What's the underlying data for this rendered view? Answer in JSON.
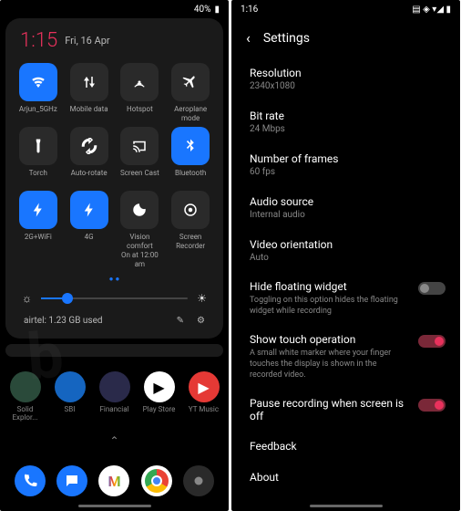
{
  "left_phone": {
    "status": {
      "battery": "40%"
    },
    "clock": {
      "time": "1:15",
      "date": "Fri, 16 Apr"
    },
    "tiles": [
      {
        "label": "Arjun_5GHz",
        "on": true,
        "icon": "wifi"
      },
      {
        "label": "Mobile data",
        "on": false,
        "icon": "data"
      },
      {
        "label": "Hotspot",
        "on": false,
        "icon": "hotspot"
      },
      {
        "label": "Aeroplane mode",
        "on": false,
        "icon": "plane"
      },
      {
        "label": "Torch",
        "on": false,
        "icon": "torch"
      },
      {
        "label": "Auto-rotate",
        "on": false,
        "icon": "rotate"
      },
      {
        "label": "Screen Cast",
        "on": false,
        "icon": "cast"
      },
      {
        "label": "Bluetooth",
        "on": true,
        "icon": "bt"
      },
      {
        "label": "2G+WiFi",
        "on": true,
        "icon": "bolt"
      },
      {
        "label": "4G",
        "on": true,
        "icon": "bolt"
      },
      {
        "label": "Vision comfort\nOn at 12:00 am",
        "on": false,
        "icon": "moon"
      },
      {
        "label": "Screen Recorder",
        "on": false,
        "icon": "record"
      }
    ],
    "data_usage": "airtel: 1.23 GB used",
    "apps_row1": [
      {
        "label": "Solid Explor...",
        "color": "#2a4a3a"
      },
      {
        "label": "SBI",
        "color": "#1565c0"
      },
      {
        "label": "Financial",
        "color": "#2a2a4a"
      },
      {
        "label": "Play Store",
        "color": "#fff"
      },
      {
        "label": "YT Music",
        "color": "#e53935"
      }
    ],
    "dock": [
      {
        "icon": "phone",
        "color": "#1976ff"
      },
      {
        "icon": "msg",
        "color": "#1976ff"
      },
      {
        "icon": "gmail",
        "color": "#fff"
      },
      {
        "icon": "chrome",
        "color": "#fff"
      },
      {
        "icon": "camera",
        "color": "#2a2a2a"
      }
    ]
  },
  "right_phone": {
    "status_time": "1:16",
    "title": "Settings",
    "items": [
      {
        "label": "Resolution",
        "sub": "2340x1080"
      },
      {
        "label": "Bit rate",
        "sub": "24 Mbps"
      },
      {
        "label": "Number of frames",
        "sub": "60 fps"
      },
      {
        "label": "Audio source",
        "sub": "Internal audio"
      },
      {
        "label": "Video orientation",
        "sub": "Auto"
      }
    ],
    "toggles": [
      {
        "label": "Hide floating widget",
        "sub": "Toggling on this option hides the floating widget while recording",
        "on": false
      },
      {
        "label": "Show touch operation",
        "sub": "A small white marker where your finger touches the display is shown in the recorded video.",
        "on": true
      },
      {
        "label": "Pause recording when screen is off",
        "sub": "",
        "on": true
      }
    ],
    "footer": [
      "Feedback",
      "About"
    ]
  }
}
